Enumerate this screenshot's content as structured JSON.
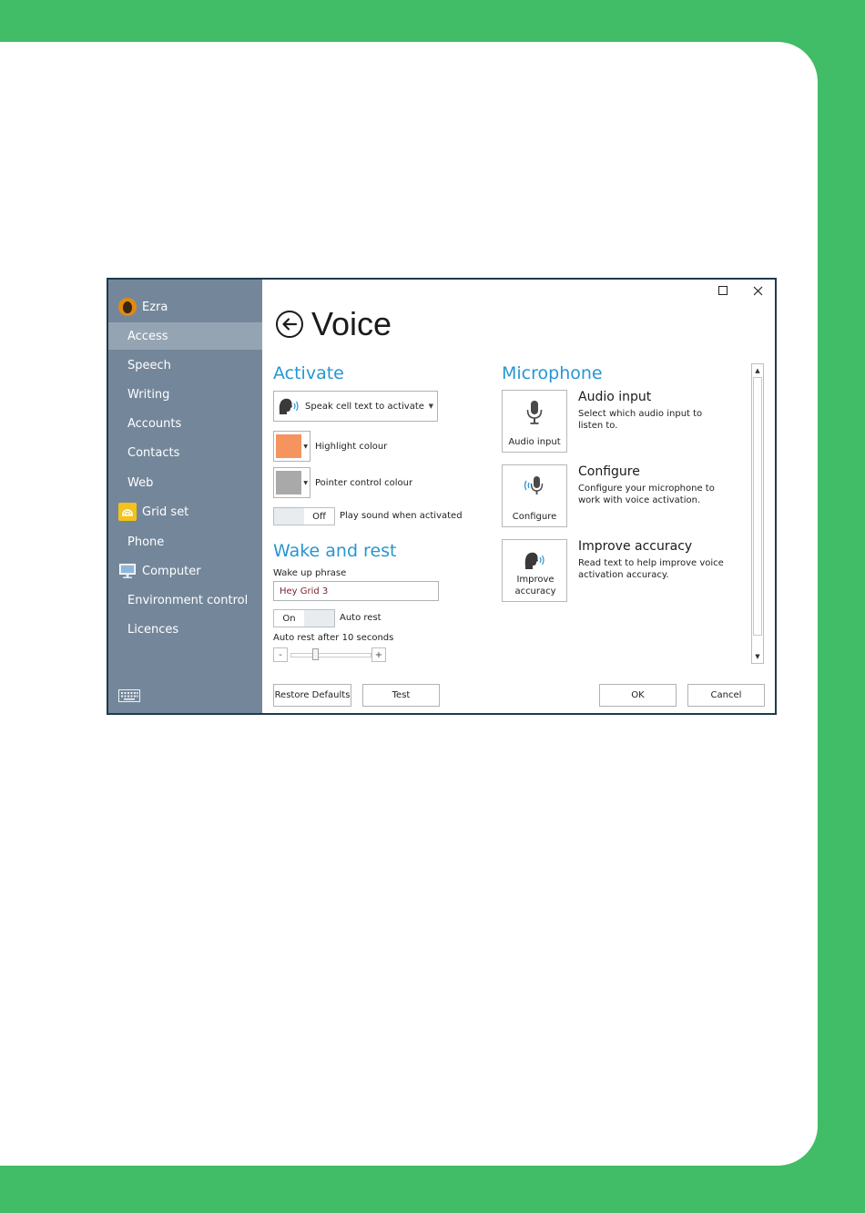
{
  "sidebar": {
    "user_name": "Ezra",
    "items": [
      {
        "label": "Access"
      },
      {
        "label": "Speech"
      },
      {
        "label": "Writing"
      },
      {
        "label": "Accounts"
      },
      {
        "label": "Contacts"
      },
      {
        "label": "Web"
      },
      {
        "label": "Grid set"
      },
      {
        "label": "Phone"
      },
      {
        "label": "Computer"
      },
      {
        "label": "Environment control"
      },
      {
        "label": "Licences"
      }
    ],
    "active_item": "Access"
  },
  "page": {
    "title": "Voice"
  },
  "activate": {
    "heading": "Activate",
    "mode_dropdown_value": "Speak cell text to activate",
    "highlight_colour_label": "Highlight colour",
    "highlight_colour": "#f5945e",
    "pointer_colour_label": "Pointer control colour",
    "pointer_colour": "#a9a9a9",
    "play_sound_state": "Off",
    "play_sound_label": "Play sound when activated"
  },
  "wake_rest": {
    "heading": "Wake and rest",
    "wake_phrase_label": "Wake up phrase",
    "wake_phrase_value": "Hey Grid 3",
    "auto_rest_state": "On",
    "auto_rest_label": "Auto rest",
    "auto_rest_after_label": "Auto rest after 10 seconds",
    "slider_minus": "-",
    "slider_plus": "+",
    "slider_level": 0.3
  },
  "microphone": {
    "heading": "Microphone",
    "audio_input": {
      "tile_label": "Audio input",
      "title": "Audio input",
      "description": "Select which audio input to listen to."
    },
    "configure": {
      "tile_label": "Configure",
      "title": "Configure",
      "description": "Configure your microphone to work with voice activation."
    },
    "improve": {
      "tile_label": "Improve accuracy",
      "title": "Improve accuracy",
      "description": "Read text to help improve voice activation accuracy."
    }
  },
  "buttons": {
    "restore_defaults": "Restore Defaults",
    "test": "Test",
    "ok": "OK",
    "cancel": "Cancel"
  },
  "colors": {
    "background_green": "#41bc67",
    "sidebar": "#74879a",
    "sidebar_active": "#95a4b3",
    "heading_blue": "#2796d2"
  },
  "icons": {
    "window": [
      "maximize-icon",
      "close-icon"
    ],
    "back": "back-arrow-icon",
    "keyboard": "keyboard-icon"
  }
}
